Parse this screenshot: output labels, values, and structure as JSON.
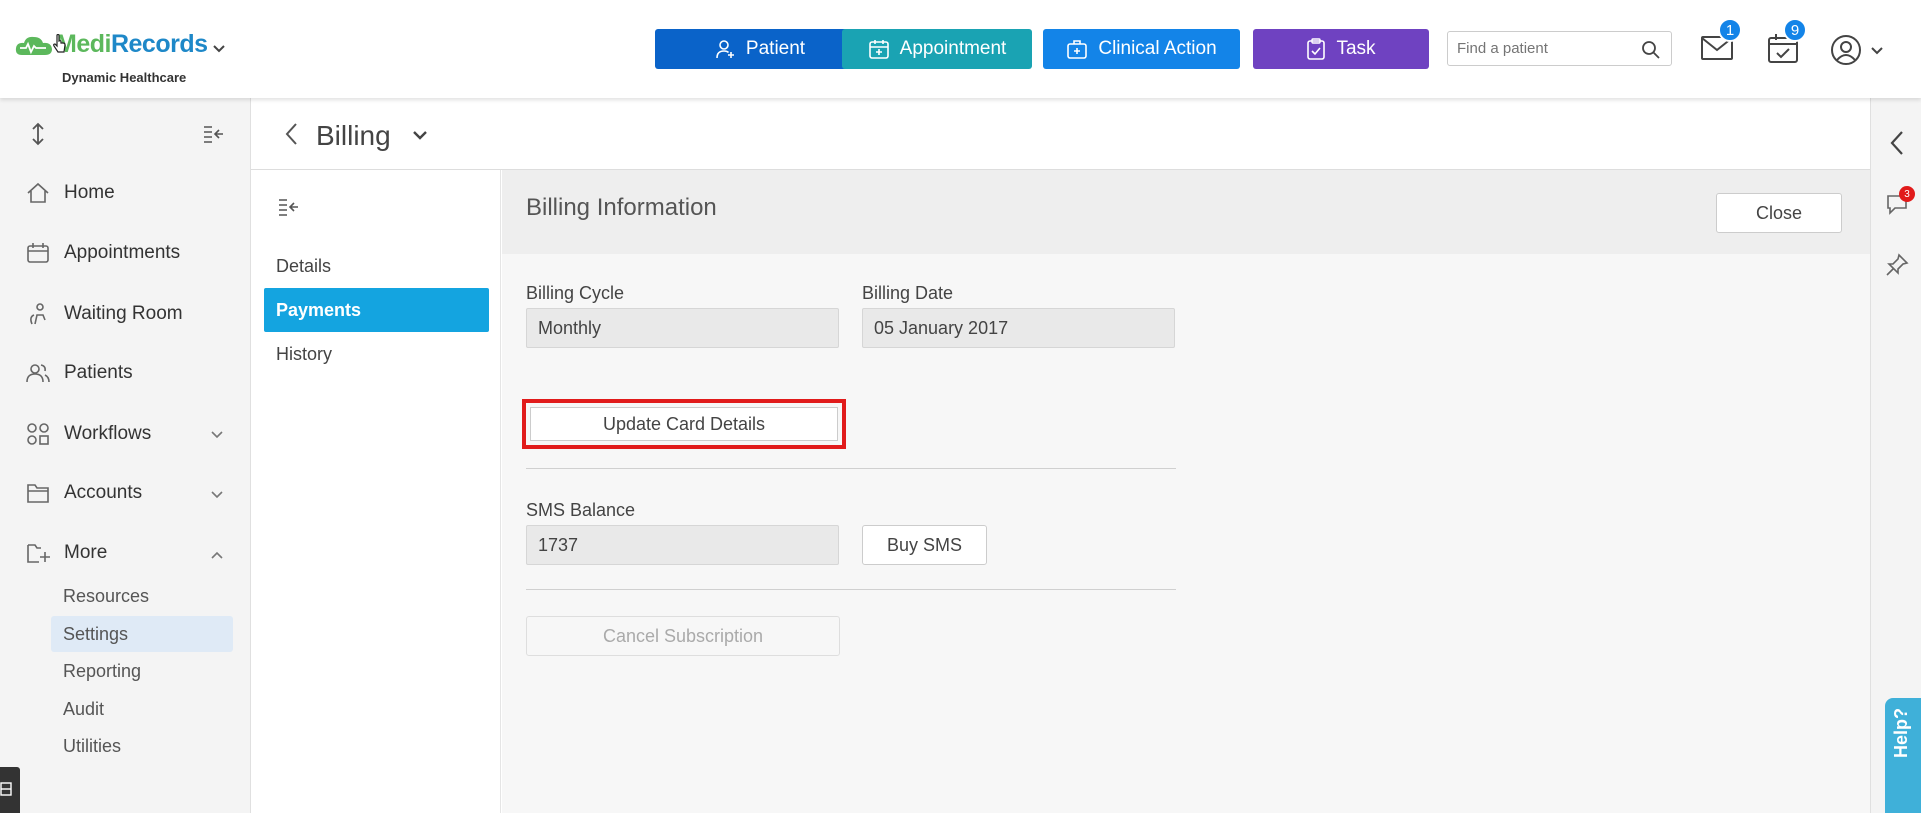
{
  "brand": {
    "name_part1": "Medi",
    "name_part2": "Records",
    "subtitle": "Dynamic Healthcare"
  },
  "header": {
    "buttons": [
      {
        "label": "Patient",
        "icon": "add-user-icon",
        "color": "#0a63c9"
      },
      {
        "label": "Appointment",
        "icon": "calendar-add-icon",
        "color": "#1aa3b3"
      },
      {
        "label": "Clinical Action",
        "icon": "medical-kit-icon",
        "color": "#1384e8"
      },
      {
        "label": "Task",
        "icon": "clipboard-check-icon",
        "color": "#6f42c1"
      }
    ],
    "search_placeholder": "Find a patient",
    "mail_badge": "1",
    "calendar_badge": "9"
  },
  "sidebar": {
    "items": [
      {
        "label": "Home",
        "icon": "home-icon"
      },
      {
        "label": "Appointments",
        "icon": "calendar-icon"
      },
      {
        "label": "Waiting Room",
        "icon": "waiting-room-icon"
      },
      {
        "label": "Patients",
        "icon": "users-icon"
      },
      {
        "label": "Workflows",
        "icon": "workflow-icon"
      },
      {
        "label": "Accounts",
        "icon": "folder-icon"
      },
      {
        "label": "More",
        "icon": "folder-plus-icon"
      }
    ],
    "more_subitems": [
      "Resources",
      "Settings",
      "Reporting",
      "Audit",
      "Utilities"
    ],
    "active_subitem": "Settings"
  },
  "page": {
    "title": "Billing"
  },
  "submenu": {
    "items": [
      "Details",
      "Payments",
      "History"
    ],
    "active": "Payments"
  },
  "billing": {
    "title": "Billing Information",
    "close_label": "Close",
    "cycle_label": "Billing Cycle",
    "cycle_value": "Monthly",
    "date_label": "Billing Date",
    "date_value": "05 January 2017",
    "update_card_label": "Update Card Details",
    "sms_label": "SMS Balance",
    "sms_value": "1737",
    "buy_sms_label": "Buy SMS",
    "cancel_label": "Cancel Subscription"
  },
  "rightrail": {
    "chat_badge": "3",
    "help_label": "Help?"
  },
  "colors": {
    "highlight": "#e11b1b",
    "active_submenu": "#14a4e0"
  }
}
